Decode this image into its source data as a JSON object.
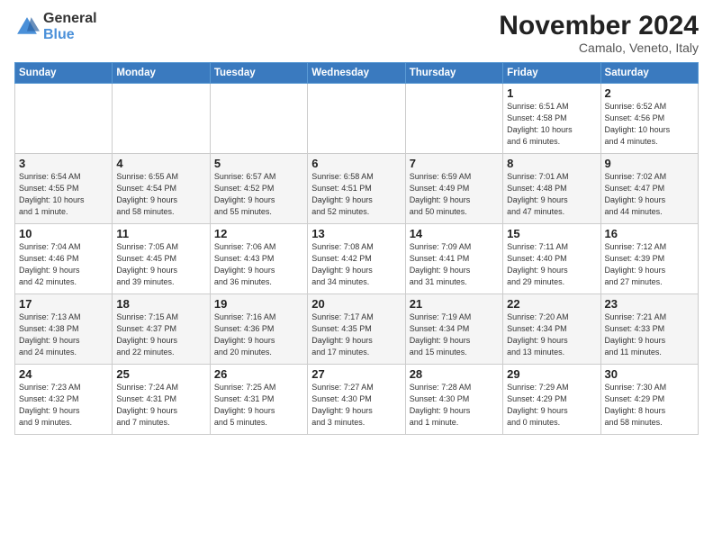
{
  "logo": {
    "general": "General",
    "blue": "Blue"
  },
  "title": "November 2024",
  "subtitle": "Camalo, Veneto, Italy",
  "columns": [
    "Sunday",
    "Monday",
    "Tuesday",
    "Wednesday",
    "Thursday",
    "Friday",
    "Saturday"
  ],
  "weeks": [
    [
      {
        "day": "",
        "info": ""
      },
      {
        "day": "",
        "info": ""
      },
      {
        "day": "",
        "info": ""
      },
      {
        "day": "",
        "info": ""
      },
      {
        "day": "",
        "info": ""
      },
      {
        "day": "1",
        "info": "Sunrise: 6:51 AM\nSunset: 4:58 PM\nDaylight: 10 hours\nand 6 minutes."
      },
      {
        "day": "2",
        "info": "Sunrise: 6:52 AM\nSunset: 4:56 PM\nDaylight: 10 hours\nand 4 minutes."
      }
    ],
    [
      {
        "day": "3",
        "info": "Sunrise: 6:54 AM\nSunset: 4:55 PM\nDaylight: 10 hours\nand 1 minute."
      },
      {
        "day": "4",
        "info": "Sunrise: 6:55 AM\nSunset: 4:54 PM\nDaylight: 9 hours\nand 58 minutes."
      },
      {
        "day": "5",
        "info": "Sunrise: 6:57 AM\nSunset: 4:52 PM\nDaylight: 9 hours\nand 55 minutes."
      },
      {
        "day": "6",
        "info": "Sunrise: 6:58 AM\nSunset: 4:51 PM\nDaylight: 9 hours\nand 52 minutes."
      },
      {
        "day": "7",
        "info": "Sunrise: 6:59 AM\nSunset: 4:49 PM\nDaylight: 9 hours\nand 50 minutes."
      },
      {
        "day": "8",
        "info": "Sunrise: 7:01 AM\nSunset: 4:48 PM\nDaylight: 9 hours\nand 47 minutes."
      },
      {
        "day": "9",
        "info": "Sunrise: 7:02 AM\nSunset: 4:47 PM\nDaylight: 9 hours\nand 44 minutes."
      }
    ],
    [
      {
        "day": "10",
        "info": "Sunrise: 7:04 AM\nSunset: 4:46 PM\nDaylight: 9 hours\nand 42 minutes."
      },
      {
        "day": "11",
        "info": "Sunrise: 7:05 AM\nSunset: 4:45 PM\nDaylight: 9 hours\nand 39 minutes."
      },
      {
        "day": "12",
        "info": "Sunrise: 7:06 AM\nSunset: 4:43 PM\nDaylight: 9 hours\nand 36 minutes."
      },
      {
        "day": "13",
        "info": "Sunrise: 7:08 AM\nSunset: 4:42 PM\nDaylight: 9 hours\nand 34 minutes."
      },
      {
        "day": "14",
        "info": "Sunrise: 7:09 AM\nSunset: 4:41 PM\nDaylight: 9 hours\nand 31 minutes."
      },
      {
        "day": "15",
        "info": "Sunrise: 7:11 AM\nSunset: 4:40 PM\nDaylight: 9 hours\nand 29 minutes."
      },
      {
        "day": "16",
        "info": "Sunrise: 7:12 AM\nSunset: 4:39 PM\nDaylight: 9 hours\nand 27 minutes."
      }
    ],
    [
      {
        "day": "17",
        "info": "Sunrise: 7:13 AM\nSunset: 4:38 PM\nDaylight: 9 hours\nand 24 minutes."
      },
      {
        "day": "18",
        "info": "Sunrise: 7:15 AM\nSunset: 4:37 PM\nDaylight: 9 hours\nand 22 minutes."
      },
      {
        "day": "19",
        "info": "Sunrise: 7:16 AM\nSunset: 4:36 PM\nDaylight: 9 hours\nand 20 minutes."
      },
      {
        "day": "20",
        "info": "Sunrise: 7:17 AM\nSunset: 4:35 PM\nDaylight: 9 hours\nand 17 minutes."
      },
      {
        "day": "21",
        "info": "Sunrise: 7:19 AM\nSunset: 4:34 PM\nDaylight: 9 hours\nand 15 minutes."
      },
      {
        "day": "22",
        "info": "Sunrise: 7:20 AM\nSunset: 4:34 PM\nDaylight: 9 hours\nand 13 minutes."
      },
      {
        "day": "23",
        "info": "Sunrise: 7:21 AM\nSunset: 4:33 PM\nDaylight: 9 hours\nand 11 minutes."
      }
    ],
    [
      {
        "day": "24",
        "info": "Sunrise: 7:23 AM\nSunset: 4:32 PM\nDaylight: 9 hours\nand 9 minutes."
      },
      {
        "day": "25",
        "info": "Sunrise: 7:24 AM\nSunset: 4:31 PM\nDaylight: 9 hours\nand 7 minutes."
      },
      {
        "day": "26",
        "info": "Sunrise: 7:25 AM\nSunset: 4:31 PM\nDaylight: 9 hours\nand 5 minutes."
      },
      {
        "day": "27",
        "info": "Sunrise: 7:27 AM\nSunset: 4:30 PM\nDaylight: 9 hours\nand 3 minutes."
      },
      {
        "day": "28",
        "info": "Sunrise: 7:28 AM\nSunset: 4:30 PM\nDaylight: 9 hours\nand 1 minute."
      },
      {
        "day": "29",
        "info": "Sunrise: 7:29 AM\nSunset: 4:29 PM\nDaylight: 9 hours\nand 0 minutes."
      },
      {
        "day": "30",
        "info": "Sunrise: 7:30 AM\nSunset: 4:29 PM\nDaylight: 8 hours\nand 58 minutes."
      }
    ]
  ]
}
